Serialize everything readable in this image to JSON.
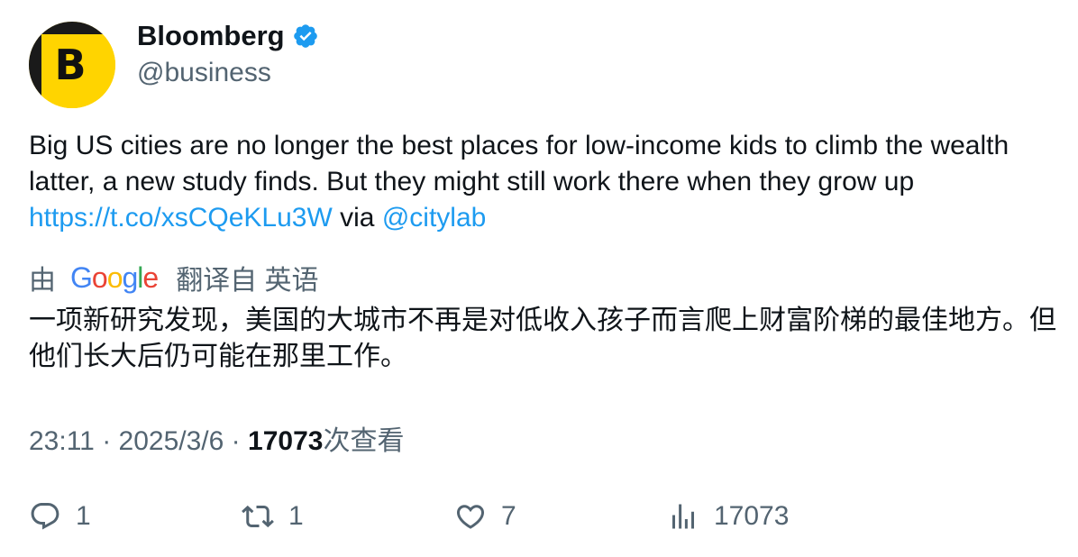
{
  "account": {
    "display_name": "Bloomberg",
    "handle": "@business",
    "avatar_letter": "B",
    "verified": true
  },
  "tweet": {
    "text_part1": "Big US cities are no longer the best places for low-income kids to climb the wealth latter, a new study finds. But they might still work there when they grow up ",
    "link": "https://t.co/xsCQeKLu3W",
    "text_part2": " via ",
    "mention": "@citylab"
  },
  "translation": {
    "by_label": "由",
    "provider": "Google",
    "from_label": "翻译自 英语",
    "text": "一项新研究发现，美国的大城市不再是对低收入孩子而言爬上财富阶梯的最佳地方。但他们长大后仍可能在那里工作。"
  },
  "meta": {
    "time": "23:11",
    "date": "2025/3/6",
    "separator": "·",
    "views_count": "17073",
    "views_label": "次查看"
  },
  "actions": {
    "replies": "1",
    "reposts": "1",
    "likes": "7",
    "views": "17073"
  },
  "colors": {
    "link": "#1d9bf0",
    "secondary_text": "#536471",
    "primary_text": "#0f1419",
    "verified": "#1d9bf0",
    "avatar_bg": "#ffd400"
  },
  "icons": {
    "reply": "reply-icon",
    "repost": "repost-icon",
    "like": "heart-icon",
    "views": "analytics-icon",
    "verified": "verified-badge-icon"
  }
}
